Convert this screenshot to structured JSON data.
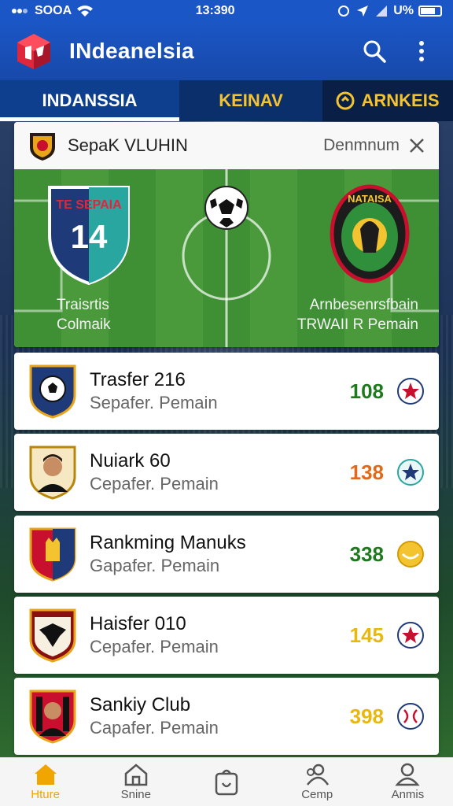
{
  "status_bar": {
    "left_text": "SOOA",
    "time": "13:390",
    "battery_text": "U%"
  },
  "app_bar": {
    "title": "INdeanelsia"
  },
  "tabs": [
    {
      "label": "INDANSSIA"
    },
    {
      "label": "KEINAV"
    },
    {
      "label": "ARNKEIS"
    }
  ],
  "match": {
    "title": "SepaK VLUHIN",
    "status": "Denmnum",
    "home_badge_text": "TE SEPAIA",
    "home_badge_number": "14",
    "home_name_line1": "Traisrtis",
    "home_name_line2": "Colmaik",
    "away_badge_text": "NATAISA",
    "away_name_line1": "Arnbesenrsfbain",
    "away_name_line2": "TRWAII R Pemain"
  },
  "list": [
    {
      "title": "Trasfer 216",
      "subtitle": "Sepafer. Pemain",
      "value": "108",
      "value_color": "#1f7a1f",
      "icon": "ball-star-icon"
    },
    {
      "title": "Nuiark 60",
      "subtitle": "Cepafer. Pemain",
      "value": "138",
      "value_color": "#e06a1a",
      "icon": "star-ball-icon"
    },
    {
      "title": "Rankming Manuks",
      "subtitle": "Gapafer. Pemain",
      "value": "338",
      "value_color": "#1f7a1f",
      "icon": "coin-icon"
    },
    {
      "title": "Haisfer 010",
      "subtitle": "Cepafer. Pemain",
      "value": "145",
      "value_color": "#e8b810",
      "icon": "ball-star-icon"
    },
    {
      "title": "Sankiy Club",
      "subtitle": "Capafer. Pemain",
      "value": "398",
      "value_color": "#e8b810",
      "icon": "ball-icon"
    }
  ],
  "bottom_nav": [
    {
      "label": "Hture",
      "icon": "home-icon"
    },
    {
      "label": "Snine",
      "icon": "house-outline-icon"
    },
    {
      "label": "",
      "icon": "bag-icon"
    },
    {
      "label": "Cemp",
      "icon": "people-icon"
    },
    {
      "label": "Anmis",
      "icon": "person-icon"
    }
  ],
  "colors": {
    "brand_blue": "#1b56c6",
    "accent_yellow": "#f4c430",
    "active_nav": "#f0a500"
  }
}
